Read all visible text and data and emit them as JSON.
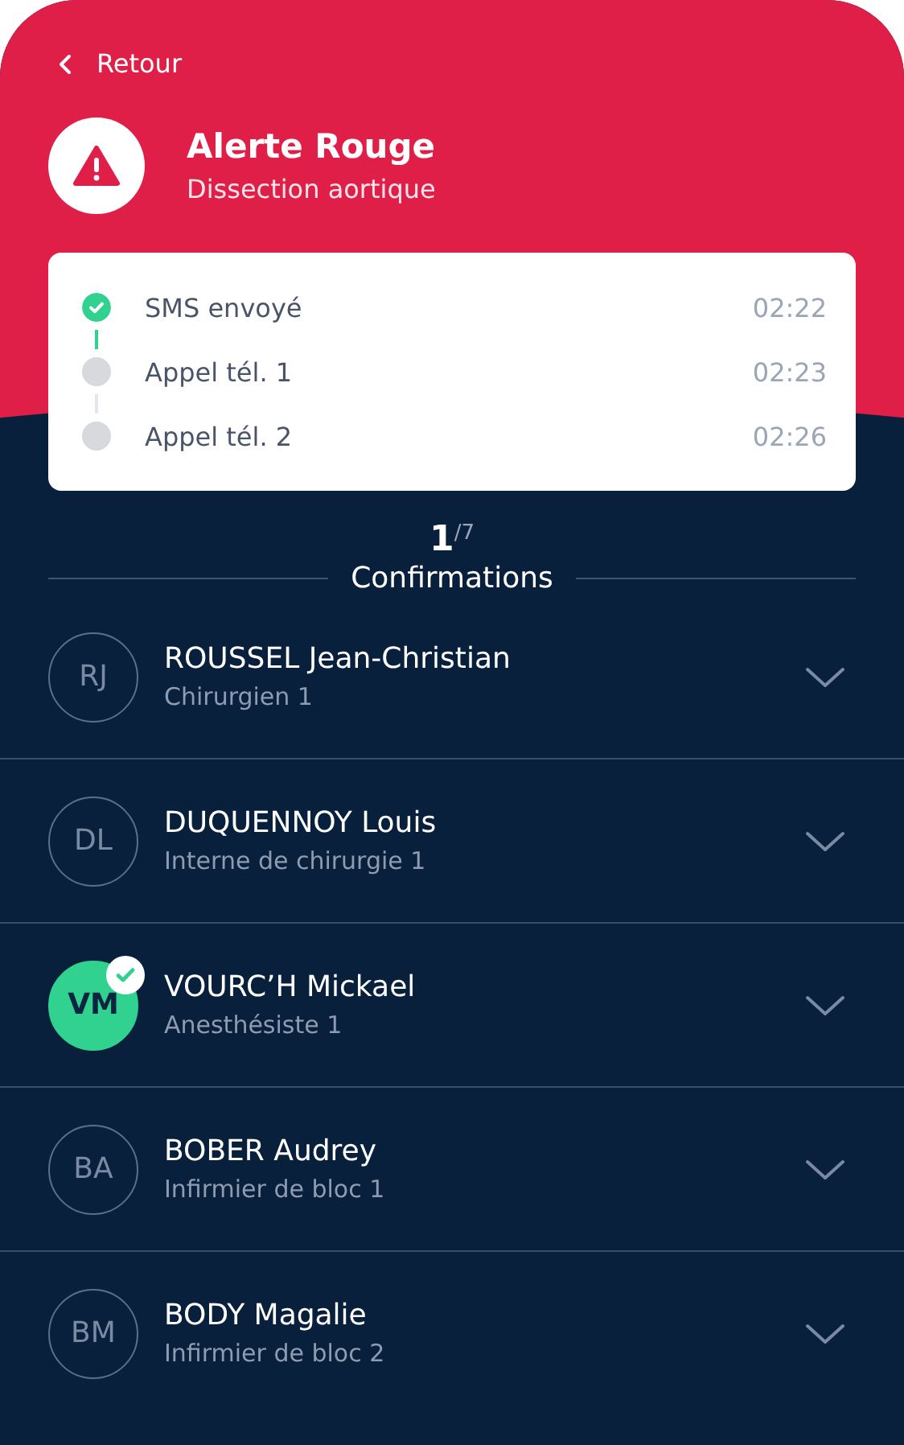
{
  "back": {
    "label": "Retour"
  },
  "alert": {
    "title": "Alerte Rouge",
    "subtitle": "Dissection aortique"
  },
  "timeline": [
    {
      "label": "SMS envoyé",
      "time": "02:22",
      "done": true
    },
    {
      "label": "Appel tél. 1",
      "time": "02:23",
      "done": false
    },
    {
      "label": "Appel tél. 2",
      "time": "02:26",
      "done": false
    }
  ],
  "confirmations": {
    "count": "1",
    "total": "/7",
    "label": "Confirmations"
  },
  "members": [
    {
      "initials": "RJ",
      "name": "ROUSSEL Jean-Christian",
      "role": "Chirurgien 1",
      "confirmed": false
    },
    {
      "initials": "DL",
      "name": "DUQUENNOY Louis",
      "role": "Interne de chirurgie 1",
      "confirmed": false
    },
    {
      "initials": "VM",
      "name": "VOURC’H Mickael",
      "role": "Anesthésiste 1",
      "confirmed": true
    },
    {
      "initials": "BA",
      "name": "BOBER Audrey",
      "role": "Infirmier de bloc 1",
      "confirmed": false
    },
    {
      "initials": "BM",
      "name": "BODY Magalie",
      "role": "Infirmier de bloc 2",
      "confirmed": false
    }
  ]
}
